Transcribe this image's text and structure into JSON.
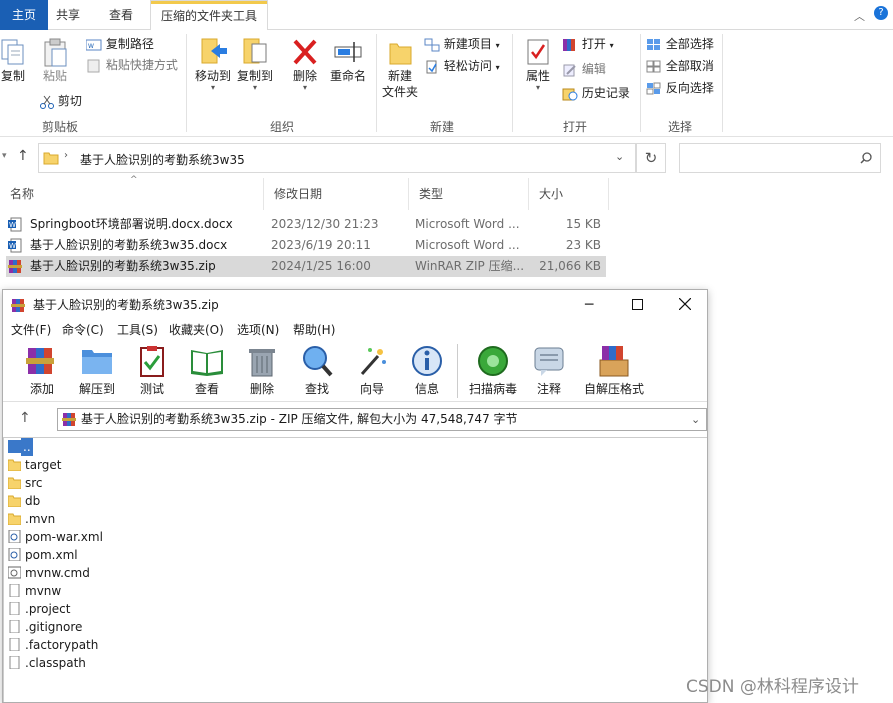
{
  "explorer": {
    "tabs": {
      "home": "主页",
      "share": "共享",
      "view": "查看",
      "tools": "压缩的文件夹工具"
    },
    "ribbon": {
      "copy": "复制",
      "paste": "粘贴",
      "copy_path": "复制路径",
      "paste_shortcut": "粘贴快捷方式",
      "cut": "剪切",
      "clipboard": "剪贴板",
      "move_to": "移动到",
      "copy_to": "复制到",
      "delete": "删除",
      "rename": "重命名",
      "organize": "组织",
      "new_item": "新建项目",
      "easy_access": "轻松访问",
      "new_folder": "新建\n文件夹",
      "new_group": "新建",
      "properties": "属性",
      "open": "打开",
      "edit": "编辑",
      "history": "历史记录",
      "open_group": "打开",
      "select_all": "全部选择",
      "select_none": "全部取消",
      "invert": "反向选择",
      "select_group": "选择"
    },
    "address": {
      "crumb": "基于人脸识别的考勤系统3w35"
    },
    "columns": {
      "name": "名称",
      "date": "修改日期",
      "type": "类型",
      "size": "大小"
    },
    "files": [
      {
        "name": "Springboot环境部署说明.docx.docx",
        "date": "2023/12/30 21:23",
        "type": "Microsoft Word ...",
        "size": "15 KB"
      },
      {
        "name": "基于人脸识别的考勤系统3w35.docx",
        "date": "2023/6/19 20:11",
        "type": "Microsoft Word ...",
        "size": "23 KB"
      },
      {
        "name": "基于人脸识别的考勤系统3w35.zip",
        "date": "2024/1/25 16:00",
        "type": "WinRAR ZIP 压缩...",
        "size": "21,066 KB"
      }
    ]
  },
  "winrar": {
    "title": "基于人脸识别的考勤系统3w35.zip",
    "menu": [
      "文件(F)",
      "命令(C)",
      "工具(S)",
      "收藏夹(O)",
      "选项(N)",
      "帮助(H)"
    ],
    "toolbar": [
      "添加",
      "解压到",
      "测试",
      "查看",
      "删除",
      "查找",
      "向导",
      "信息",
      "扫描病毒",
      "注释",
      "自解压格式"
    ],
    "path": "基于人脸识别的考勤系统3w35.zip - ZIP 压缩文件, 解包大小为 47,548,747 字节",
    "entries": [
      {
        "name": "..",
        "kind": "up"
      },
      {
        "name": "target",
        "kind": "folder"
      },
      {
        "name": "src",
        "kind": "folder"
      },
      {
        "name": "db",
        "kind": "folder"
      },
      {
        "name": ".mvn",
        "kind": "folder"
      },
      {
        "name": "pom-war.xml",
        "kind": "xml"
      },
      {
        "name": "pom.xml",
        "kind": "xml"
      },
      {
        "name": "mvnw.cmd",
        "kind": "cmd"
      },
      {
        "name": "mvnw",
        "kind": "file"
      },
      {
        "name": ".project",
        "kind": "file"
      },
      {
        "name": ".gitignore",
        "kind": "file"
      },
      {
        "name": ".factorypath",
        "kind": "file"
      },
      {
        "name": ".classpath",
        "kind": "file"
      }
    ]
  },
  "watermark": "CSDN @林科程序设计"
}
